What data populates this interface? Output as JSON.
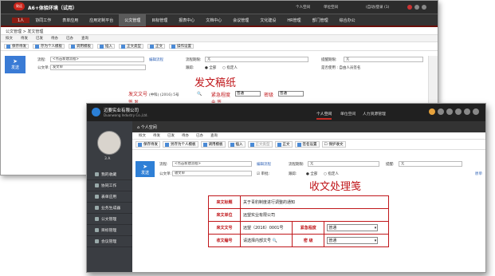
{
  "back": {
    "header": {
      "logo": "致远",
      "title": "A6+体验环境（试用）",
      "user": "个人空间",
      "unit": "单位空间",
      "group": "(自动)登录 (1)"
    },
    "user_badge": "1人",
    "nav": [
      "协同工作",
      "表单应用",
      "应用定制平台",
      "公文管理",
      "目标管理",
      "报表中心",
      "文档中心",
      "会议管理",
      "文化建设",
      "HR管理",
      "部门管理",
      "综合办公"
    ],
    "breadcrumb": "公文管理 > 发文管理",
    "tabs": [
      "拟文",
      "待发",
      "已发",
      "待办",
      "已办",
      "查询"
    ],
    "toolbar": [
      "保存待发",
      "存为个人模板",
      "调用模板",
      "插入",
      "正文类型",
      "正文",
      "操作设置"
    ],
    "send_label": "发送",
    "form": {
      "flow_label": "流程:",
      "flow_value": "<点击新建流程>",
      "flow_btn": "编辑流程",
      "deadline_label": "流程期限:",
      "deadline_value": "无",
      "remind_label": "提醒期限:",
      "remind_value": "无",
      "subject_label": "公文单:",
      "subject_value": "发文单",
      "track_label": "跟踪:",
      "all": "全部",
      "assign": "指定人",
      "note": "是否在转发 指定人",
      "extra": "是否使用 : 自由人员签名"
    },
    "doc_title": "发文稿纸",
    "fields": {
      "num_label": "发文文号",
      "num_value": "(中科) (2016) 5号",
      "urgency_label": "紧急程度",
      "urgency_value": "普通",
      "secret_label": "密级",
      "secret_value": "普通",
      "row2_a": "签 发",
      "row2_b": "会 签"
    }
  },
  "front": {
    "header": {
      "company": "迈要实业有限公司",
      "company_en": "Duanwang Industry Co.,Ltd.",
      "tabs": [
        "个人空间",
        "单位空间",
        "人力资源管理"
      ]
    },
    "space_label": "个人空间",
    "user_name": "3 A",
    "sidebar": [
      "我的收藏",
      "协同工作",
      "表单应用",
      "业务生成器",
      "公文管理",
      "目标管理",
      "会议管理"
    ],
    "tabs": [
      "拟文",
      "待发",
      "已发",
      "待办",
      "已办",
      "查询"
    ],
    "toolbar": [
      "保存待发",
      "另存为个人模板",
      "调用模板",
      "插入",
      "正文类型",
      "正文",
      "签名设置",
      "保护收文"
    ],
    "send_label": "发送",
    "form": {
      "flow_label": "流程:",
      "flow_value": "<点击新建流程>",
      "flow_btn": "编辑流程",
      "deadline_label": "流程期限:",
      "deadline_value": "无",
      "remind_label": "提醒:",
      "remind_value": "无",
      "subject_label": "公文单:",
      "subject_value": "收文单",
      "approve_label": "审批:",
      "track_label": "跟踪:",
      "all": "全部",
      "assign": "指定人",
      "link": "原单"
    },
    "doc_title": "收文处理笺",
    "rows": {
      "title_label": "来文标题",
      "title_value": "关于青豹制度进行调整的通知",
      "org_label": "来文单位",
      "org_value": "远望实业有限公司",
      "num_label": "来文文号",
      "num_value": "远望（2016）0001号",
      "urgency_label": "紧急程度",
      "urgency_value": "普通",
      "recv_label": "收文编号",
      "recv_value": "请选择内部文号",
      "secret_label": "密 级",
      "secret_value": "普通"
    }
  }
}
